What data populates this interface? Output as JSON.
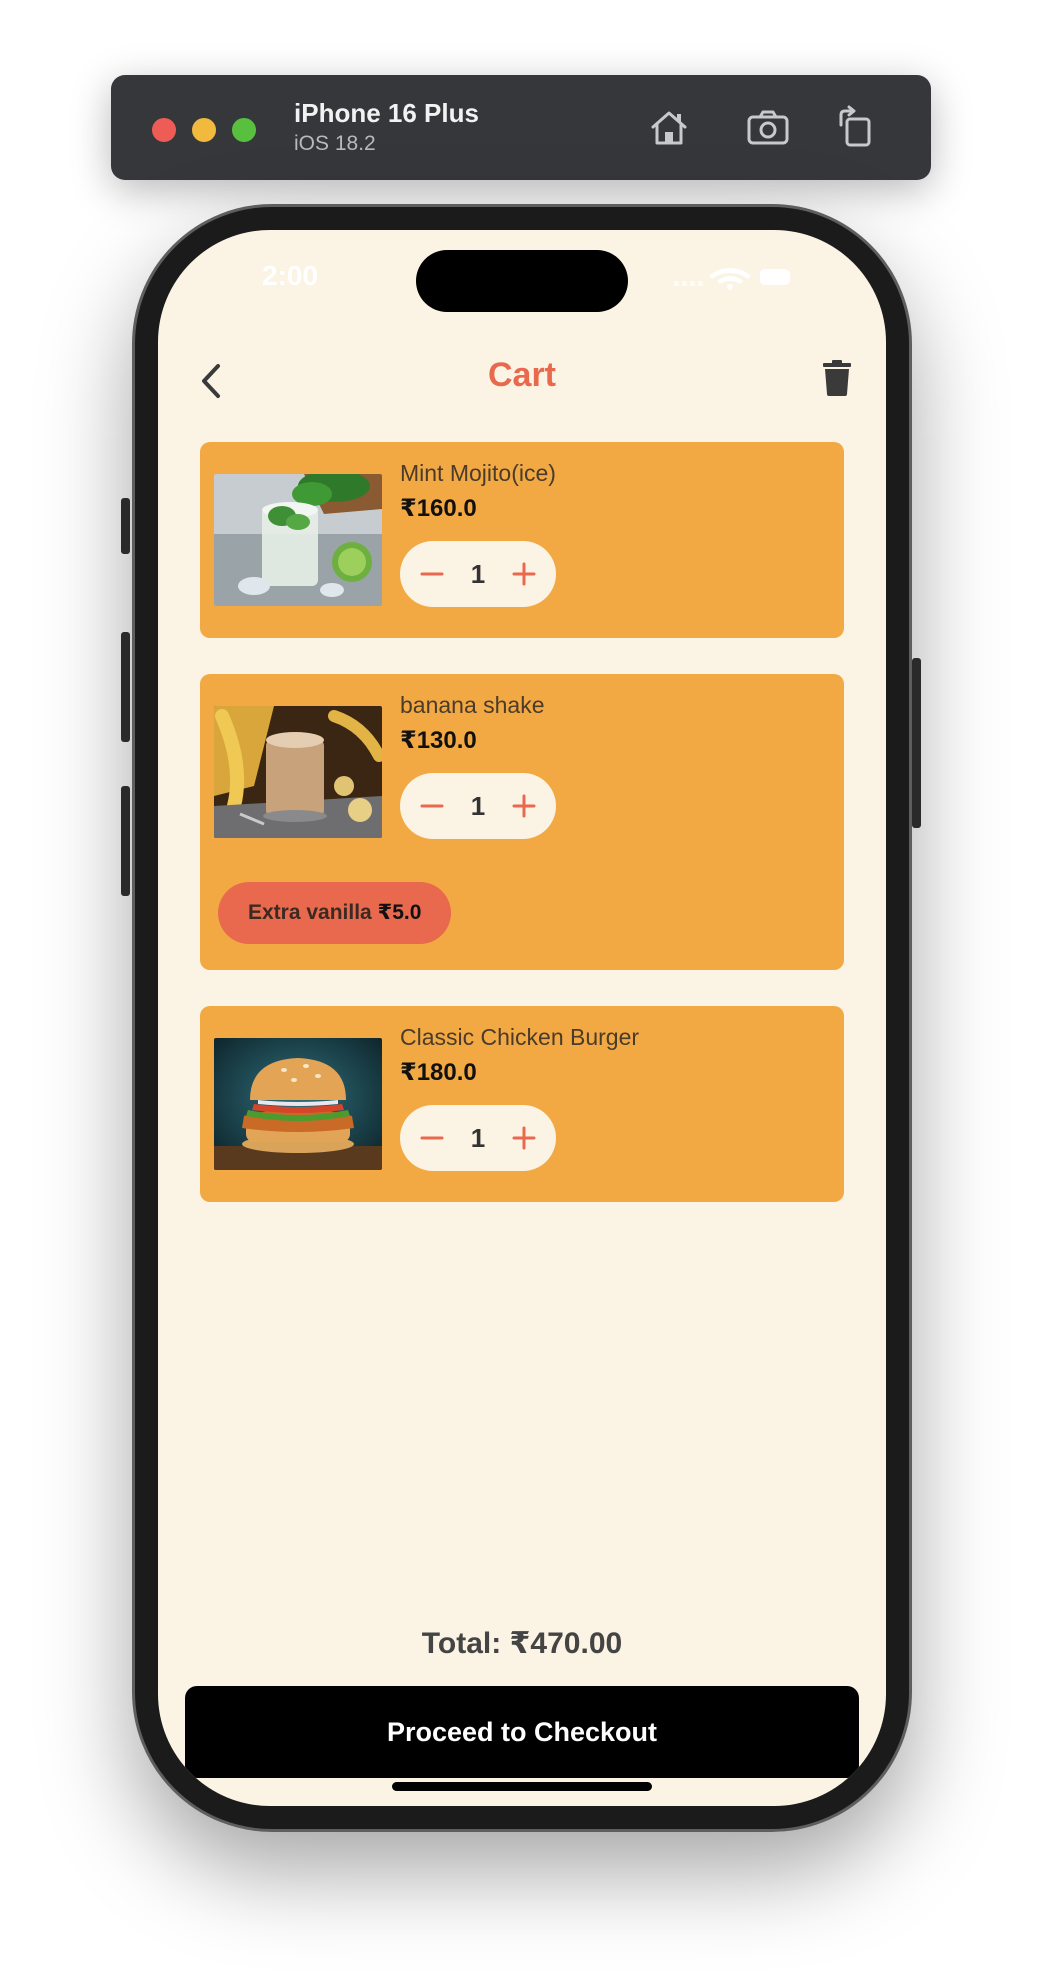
{
  "simulator": {
    "device_name": "iPhone 16 Plus",
    "os_version": "iOS 18.2",
    "icons": [
      "home-icon",
      "screenshot-icon",
      "rotate-icon"
    ]
  },
  "status_bar": {
    "time": "2:00",
    "icons": [
      "signal-icon",
      "wifi-icon",
      "battery-icon"
    ]
  },
  "app_bar": {
    "title": "Cart",
    "back_icon": "chevron-left-icon",
    "clear_icon": "trash-icon"
  },
  "cart": {
    "items": [
      {
        "name": "Mint Mojito(ice)",
        "price": "₹160.0",
        "quantity": "1",
        "image": "mint-mojito-glass",
        "addons": []
      },
      {
        "name": "banana shake",
        "price": "₹130.0",
        "quantity": "1",
        "image": "banana-shake-glass",
        "addons": [
          {
            "name": "Extra vanilla",
            "price": "₹5.0"
          }
        ]
      },
      {
        "name": "Classic Chicken Burger",
        "price": "₹180.0",
        "quantity": "1",
        "image": "chicken-burger",
        "addons": []
      }
    ],
    "total_label": "Total: ₹470.00",
    "checkout_label": "Proceed to Checkout"
  },
  "colors": {
    "background": "#fbf3e3",
    "card": "#f2a944",
    "accent": "#e8694d",
    "checkout_button": "#000000"
  }
}
